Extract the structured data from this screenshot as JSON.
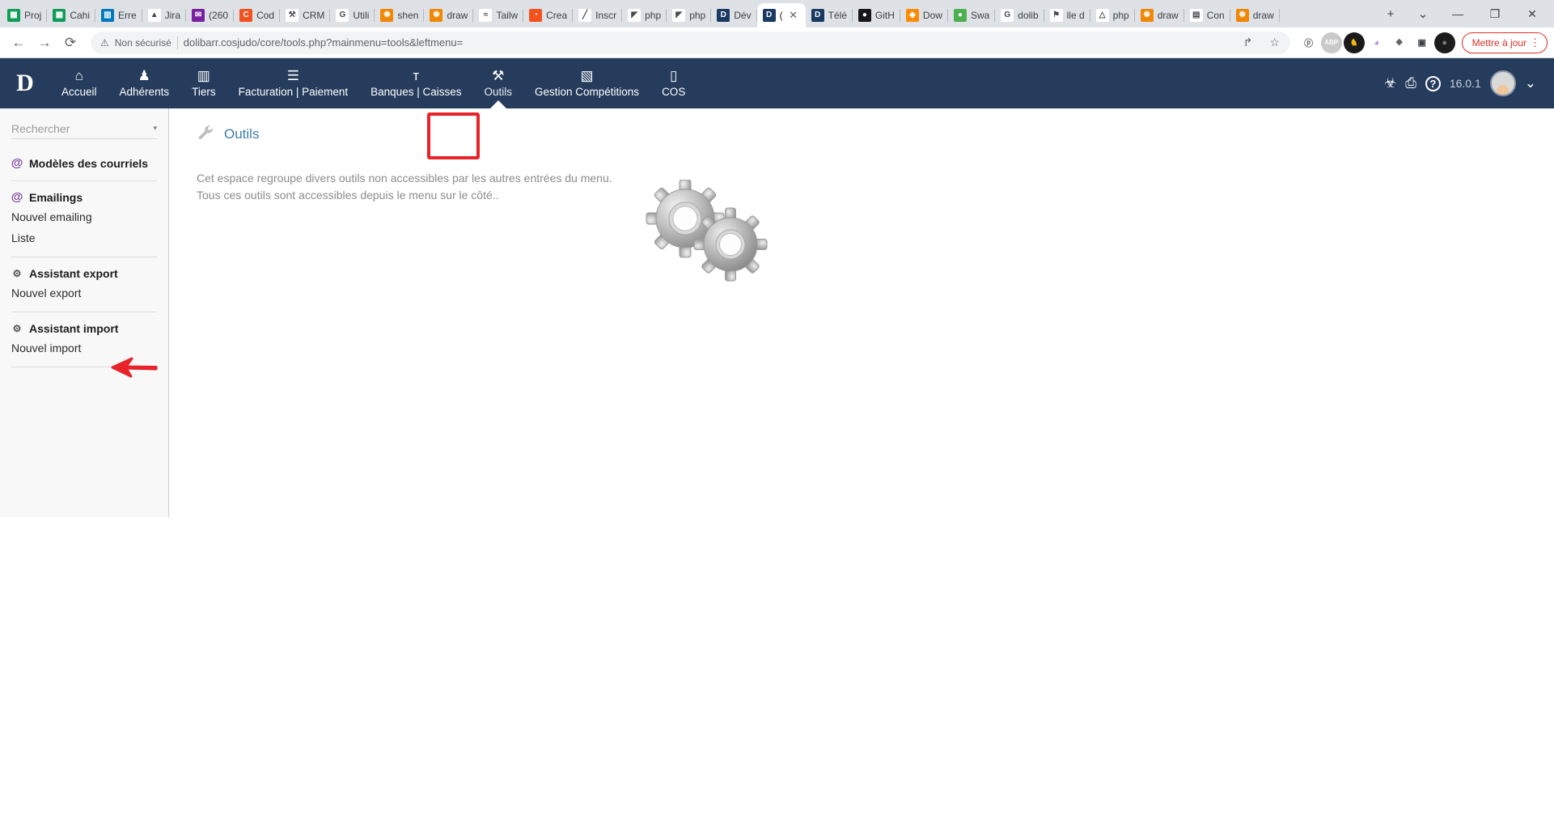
{
  "browser": {
    "tabs": [
      {
        "title": "Proj",
        "icon": "sheets-icon",
        "color": "#0f9d58",
        "glyph": "▦"
      },
      {
        "title": "Cahi",
        "icon": "sheets-icon",
        "color": "#0f9d58",
        "glyph": "▦"
      },
      {
        "title": "Erre",
        "icon": "trello-icon",
        "color": "#0079bf",
        "glyph": "▥"
      },
      {
        "title": "Jira",
        "icon": "jira-icon",
        "color": "#ffffff",
        "glyph": "▲"
      },
      {
        "title": "(260",
        "icon": "mail-icon",
        "color": "#7b1fa2",
        "glyph": "✉"
      },
      {
        "title": "Cod",
        "icon": "codepen-icon",
        "color": "#f4511e",
        "glyph": "C"
      },
      {
        "title": "CRM",
        "icon": "crm-icon",
        "color": "#ffffff",
        "glyph": "⚒"
      },
      {
        "title": "Utili",
        "icon": "google-icon",
        "color": "#ffffff",
        "glyph": "G"
      },
      {
        "title": "shen",
        "icon": "drawio-icon",
        "color": "#f08705",
        "glyph": "☸"
      },
      {
        "title": "draw",
        "icon": "drawio-icon",
        "color": "#f08705",
        "glyph": "☸"
      },
      {
        "title": "Tailw",
        "icon": "tailwind-icon",
        "color": "#ffffff",
        "glyph": "≈"
      },
      {
        "title": "Crea",
        "icon": "creative-icon",
        "color": "#f4511e",
        "glyph": "◔"
      },
      {
        "title": "Inscr",
        "icon": "pencil-icon",
        "color": "#ffffff",
        "glyph": "╱"
      },
      {
        "title": "php",
        "icon": "phpmyadmin-icon",
        "color": "#ffffff",
        "glyph": "◤"
      },
      {
        "title": "php",
        "icon": "phpmyadmin-icon",
        "color": "#ffffff",
        "glyph": "◤"
      },
      {
        "title": "Dév",
        "icon": "dolibarr-icon",
        "color": "#1a3a63",
        "glyph": "D"
      },
      {
        "title": "(",
        "icon": "dolibarr-icon",
        "color": "#1a3a63",
        "glyph": "D",
        "active": true
      },
      {
        "title": "Télé",
        "icon": "dolibarr-icon",
        "color": "#1a3a63",
        "glyph": "D"
      },
      {
        "title": "GitH",
        "icon": "github-icon",
        "color": "#181717",
        "glyph": "●"
      },
      {
        "title": "Dow",
        "icon": "sourcetree-icon",
        "color": "#ff8b00",
        "glyph": "◆"
      },
      {
        "title": "Swa",
        "icon": "swagger-icon",
        "color": "#4caf50",
        "glyph": "●"
      },
      {
        "title": "dolib",
        "icon": "google-icon",
        "color": "#ffffff",
        "glyph": "G"
      },
      {
        "title": "lle d",
        "icon": "maps-icon",
        "color": "#ffffff",
        "glyph": "⚑"
      },
      {
        "title": "php",
        "icon": "drive-icon",
        "color": "#ffffff",
        "glyph": "△"
      },
      {
        "title": "draw",
        "icon": "drawio-icon",
        "color": "#f08705",
        "glyph": "☸"
      },
      {
        "title": "Con",
        "icon": "chart-icon",
        "color": "#ffffff",
        "glyph": "▤"
      },
      {
        "title": "draw",
        "icon": "drawio-icon",
        "color": "#f08705",
        "glyph": "☸"
      }
    ],
    "new_tab_label": "+",
    "tab_search_label": "⌄",
    "window_minimize": "—",
    "window_maximize": "❐",
    "window_close": "✕",
    "nav": {
      "back": "←",
      "forward": "→",
      "reload": "⟳"
    },
    "omnibox": {
      "warning_icon": "⚠",
      "security_label": "Non sécurisé",
      "url": "dolibarr.cosjudo/core/tools.php?mainmenu=tools&leftmenu=",
      "share_icon": "↱",
      "bookmark_icon": "☆"
    },
    "extensions": [
      {
        "name": "pinterest-extension",
        "glyph": "ⓟ",
        "bg": "#ffffff",
        "fg": "#6b6b6b"
      },
      {
        "name": "adblock-plus-extension",
        "glyph": "ABP",
        "bg": "#c9c9c9",
        "fg": "#ffffff"
      },
      {
        "name": "metamask-extension",
        "glyph": "♞",
        "bg": "#1a1a1a",
        "fg": "#f0b90b"
      },
      {
        "name": "colorzilla-extension",
        "glyph": "◕",
        "bg": "#ffffff",
        "fg": "#b07fe0"
      },
      {
        "name": "puzzle-extensions-icon",
        "glyph": "❖",
        "bg": "#ffffff",
        "fg": "#5f6368"
      },
      {
        "name": "sidepanel-icon",
        "glyph": "▣",
        "bg": "#ffffff",
        "fg": "#3c4043"
      },
      {
        "name": "profile-avatar",
        "glyph": "●",
        "bg": "#1c1c1c",
        "fg": "#7a7a7a"
      }
    ],
    "update_button": "Mettre à jour",
    "menu_dots": "⋮"
  },
  "app": {
    "logo": "D",
    "topnav": [
      {
        "label": "Accueil",
        "icon": "home-icon",
        "glyph": "⌂"
      },
      {
        "label": "Adhérents",
        "icon": "user-icon",
        "glyph": "♟"
      },
      {
        "label": "Tiers",
        "icon": "building-icon",
        "glyph": "▥"
      },
      {
        "label": "Facturation | Paiement",
        "icon": "invoice-icon",
        "glyph": "☰"
      },
      {
        "label": "Banques | Caisses",
        "icon": "bank-icon",
        "glyph": "ᴛ"
      },
      {
        "label": "Outils",
        "icon": "wrench-icon",
        "glyph": "⚒",
        "current": true
      },
      {
        "label": "Gestion Compétitions",
        "icon": "note-icon",
        "glyph": "▧"
      },
      {
        "label": "COS",
        "icon": "page-icon",
        "glyph": "▯"
      }
    ],
    "topnav_right": {
      "bug_icon": "☣",
      "print_icon": "⎙",
      "help_icon": "?",
      "version": "16.0.1",
      "chevron": "⌄"
    },
    "sidebar": {
      "search_placeholder": "Rechercher",
      "search_value": "",
      "caret": "▾",
      "groups": [
        {
          "title": "Modèles des courriels",
          "icon": "at-icon",
          "icon_glyph": "@",
          "items": []
        },
        {
          "title": "Emailings",
          "icon": "at-icon",
          "icon_glyph": "@",
          "items": [
            "Nouvel emailing",
            "Liste"
          ]
        },
        {
          "title": "Assistant export",
          "icon": "gears-icon",
          "icon_glyph": "⚙",
          "items": [
            "Nouvel export"
          ]
        },
        {
          "title": "Assistant import",
          "icon": "gears-icon",
          "icon_glyph": "⚙",
          "items": [
            "Nouvel import"
          ]
        }
      ]
    },
    "content": {
      "page_icon": "wrench-icon",
      "page_icon_glyph": "⚒",
      "title": "Outils",
      "description_line1": "Cet espace regroupe divers outils non accessibles par les autres entrées du menu.",
      "description_line2": "Tous ces outils sont accessibles depuis le menu sur le côté.."
    },
    "annotations": {
      "highlight_target": "Outils",
      "arrow_target": "Nouvel export",
      "color": "#e8232a"
    }
  }
}
